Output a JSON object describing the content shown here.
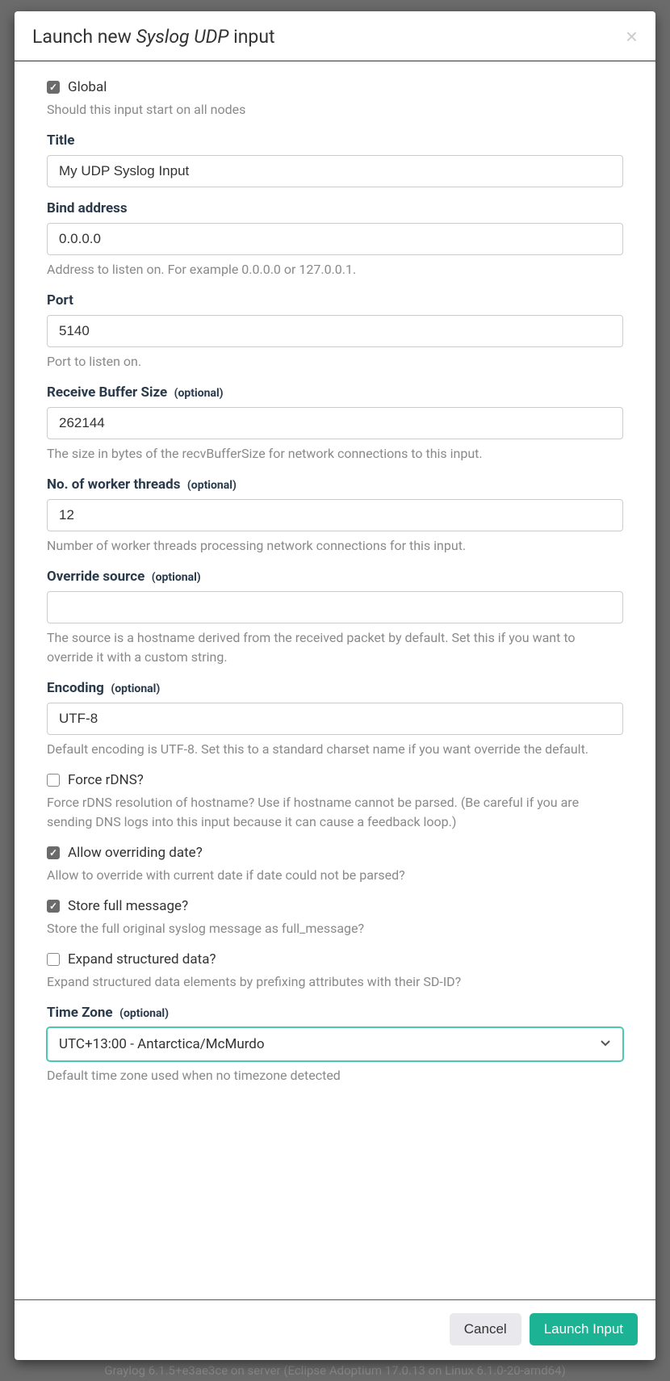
{
  "modal": {
    "title_prefix": "Launch new ",
    "title_em": "Syslog UDP",
    "title_suffix": " input"
  },
  "form": {
    "global": {
      "label": "Global",
      "checked": true,
      "help": "Should this input start on all nodes"
    },
    "title": {
      "label": "Title",
      "value": "My UDP Syslog Input"
    },
    "bind_address": {
      "label": "Bind address",
      "value": "0.0.0.0",
      "help": "Address to listen on. For example 0.0.0.0 or 127.0.0.1."
    },
    "port": {
      "label": "Port",
      "value": "5140",
      "help": "Port to listen on."
    },
    "recv_buffer": {
      "label": "Receive Buffer Size",
      "optional": "(optional)",
      "value": "262144",
      "help": "The size in bytes of the recvBufferSize for network connections to this input."
    },
    "worker_threads": {
      "label": "No. of worker threads",
      "optional": "(optional)",
      "value": "12",
      "help": "Number of worker threads processing network connections for this input."
    },
    "override_source": {
      "label": "Override source",
      "optional": "(optional)",
      "value": "",
      "help": "The source is a hostname derived from the received packet by default. Set this if you want to override it with a custom string."
    },
    "encoding": {
      "label": "Encoding",
      "optional": "(optional)",
      "value": "UTF-8",
      "help": "Default encoding is UTF-8. Set this to a standard charset name if you want override the default."
    },
    "force_rdns": {
      "label": "Force rDNS?",
      "checked": false,
      "help": "Force rDNS resolution of hostname? Use if hostname cannot be parsed. (Be careful if you are sending DNS logs into this input because it can cause a feedback loop.)"
    },
    "allow_override_date": {
      "label": "Allow overriding date?",
      "checked": true,
      "help": "Allow to override with current date if date could not be parsed?"
    },
    "store_full": {
      "label": "Store full message?",
      "checked": true,
      "help": "Store the full original syslog message as full_message?"
    },
    "expand_structured": {
      "label": "Expand structured data?",
      "checked": false,
      "help": "Expand structured data elements by prefixing attributes with their SD-ID?"
    },
    "timezone": {
      "label": "Time Zone",
      "optional": "(optional)",
      "value": "UTC+13:00 - Antarctica/McMurdo",
      "help": "Default time zone used when no timezone detected"
    }
  },
  "footer": {
    "cancel": "Cancel",
    "submit": "Launch Input"
  },
  "bg_footer": "Graylog 6.1.5+e3ae3ce on server (Eclipse Adoptium 17.0.13 on Linux 6.1.0-20-amd64)"
}
